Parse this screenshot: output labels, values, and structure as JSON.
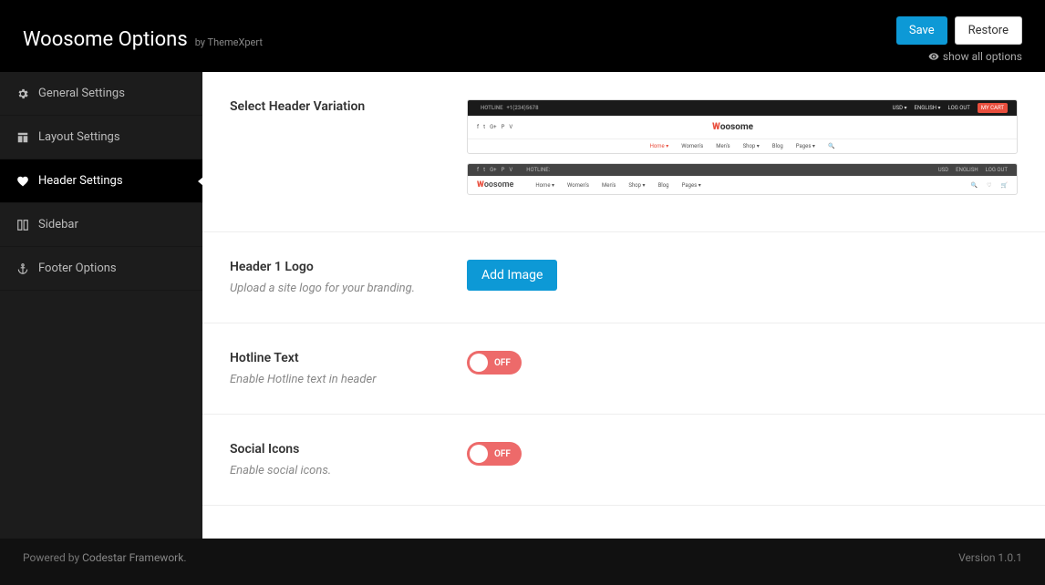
{
  "header": {
    "title": "Woosome Options",
    "byline": "by ThemeXpert",
    "save_label": "Save",
    "restore_label": "Restore",
    "show_all_label": "show all options"
  },
  "sidebar": {
    "items": [
      {
        "label": "General Settings"
      },
      {
        "label": "Layout Settings"
      },
      {
        "label": "Header Settings"
      },
      {
        "label": "Sidebar"
      },
      {
        "label": "Footer Options"
      }
    ]
  },
  "options": {
    "header_variation": {
      "title": "Select Header Variation",
      "preview1": {
        "hotline": "HOTLINE",
        "phone": "+1(234)5678",
        "usd": "USD ▾",
        "lang": "ENGLISH ▾",
        "logout": "LOG OUT",
        "cart": "MY CART",
        "brand_prefix": "W",
        "brand_rest": "oosome",
        "nav": {
          "home": "Home ▾",
          "women": "Women's",
          "men": "Men's",
          "shop": "Shop ▾",
          "blog": "Blog",
          "pages": "Pages ▾"
        }
      },
      "preview2": {
        "hotline_label": "HOTLINE:",
        "usd": "USD",
        "lang": "ENGLISH",
        "logout": "LOG OUT",
        "brand_prefix": "W",
        "brand_rest": "oosome",
        "nav": {
          "home": "Home ▾",
          "women": "Women's",
          "men": "Men's",
          "shop": "Shop ▾",
          "blog": "Blog",
          "pages": "Pages ▾"
        }
      }
    },
    "logo": {
      "title": "Header 1 Logo",
      "desc": "Upload a site logo for your branding.",
      "button": "Add Image"
    },
    "hotline": {
      "title": "Hotline Text",
      "desc": "Enable Hotline text in header",
      "state": "OFF"
    },
    "social": {
      "title": "Social Icons",
      "desc": "Enable social icons.",
      "state": "OFF"
    }
  },
  "footer": {
    "powered_prefix": "Powered by ",
    "powered_link": "Codestar Framework",
    "powered_suffix": ".",
    "version": "Version 1.0.1"
  }
}
